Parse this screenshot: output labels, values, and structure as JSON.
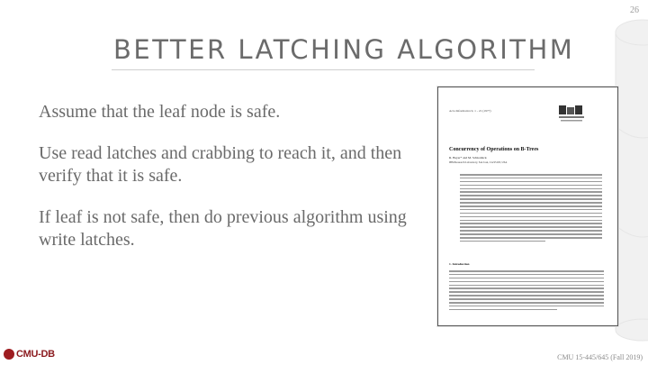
{
  "slide_number": "26",
  "title": "BETTER LATCHING ALGORITHM",
  "bullets": [
    "Assume that the leaf node is safe.",
    "Use read latches and crabbing to reach it, and then verify that it is safe.",
    "If leaf is not safe, then do previous algorithm using write latches."
  ],
  "paper": {
    "header": "Acta Informatica 9, 1 - 21 (1977)",
    "title": "Concurrency of Operations on B-Trees",
    "authors": "R. Bayer* and M. Schkolnick",
    "affiliation": "IBM Research Laboratory, San José, CA 95193, USA",
    "section": "1. Introduction"
  },
  "logo_text": "CMU-DB",
  "footer": "CMU 15-445/645 (Fall 2019)",
  "colors": {
    "accent": "#9e1c20",
    "title": "#6b6b6b",
    "body_text": "#6a6a6a"
  }
}
